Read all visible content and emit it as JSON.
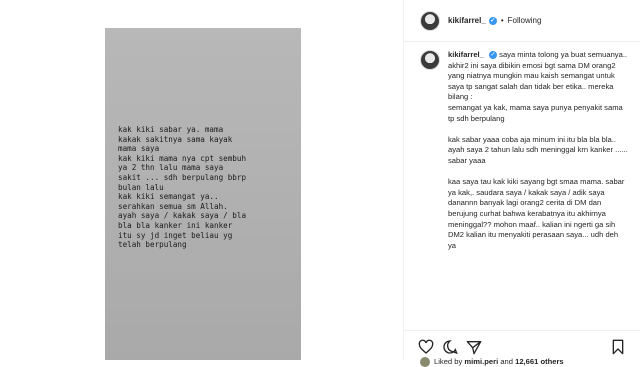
{
  "header": {
    "username": "kikifarrel_",
    "separator": "•",
    "follow_status": "Following"
  },
  "story": {
    "text": "kak kiki sabar ya. mama\nkakak sakitnya sama kayak\nmama saya\nkak kiki mama nya cpt sembuh\nya 2 thn lalu mama saya\nsakit ... sdh berpulang bbrp\nbulan lalu\nkak kiki semangat ya..\nserahkan semua sm Allah.\nayah saya / kakak saya / bla\nbla bla kanker ini kanker\nitu sy jd inget beliau yg\ntelah berpulang"
  },
  "caption": {
    "username": "kikifarrel_",
    "paragraphs": [
      "saya minta tolong ya buat semuanya.. akhir2 ini saya dibikin emosi bgt sama DM orang2 yang niatnya mungkin mau kaish semangat untuk saya tp sangat salah dan tidak ber etika.. mereka bilang :\nsemangat ya kak, mama saya punya penyakit sama tp sdh berpulang",
      "kak sabar yaaa coba aja minum ini itu bla bla bla.. ayah saya 2 tahun lalu sdh meninggal krn kanker ...... sabar yaaa",
      "kaa saya tau kak kiki sayang bgt smaa mama. sabar ya kak,. saudara saya / kakak saya / adik saya danannn banyak lagi orang2 cerita di DM dan berujung curhat bahwa kerabatnya itu akhirnya meninggal?? mohon maaf.. kalian ini ngerti ga sih DM2 kalian itu menyakiti perasaan saya... udh deh ya"
    ]
  },
  "likes": {
    "prefix": "Liked by",
    "user": "mimi.peri",
    "conjunction": "and",
    "count": "12,661 others"
  },
  "icons": [
    "heart-icon",
    "comment-icon",
    "share-icon",
    "bookmark-icon",
    "verified-icon"
  ],
  "colors": {
    "verified": "#3897f0",
    "story_bg": "#b0b0b0"
  }
}
